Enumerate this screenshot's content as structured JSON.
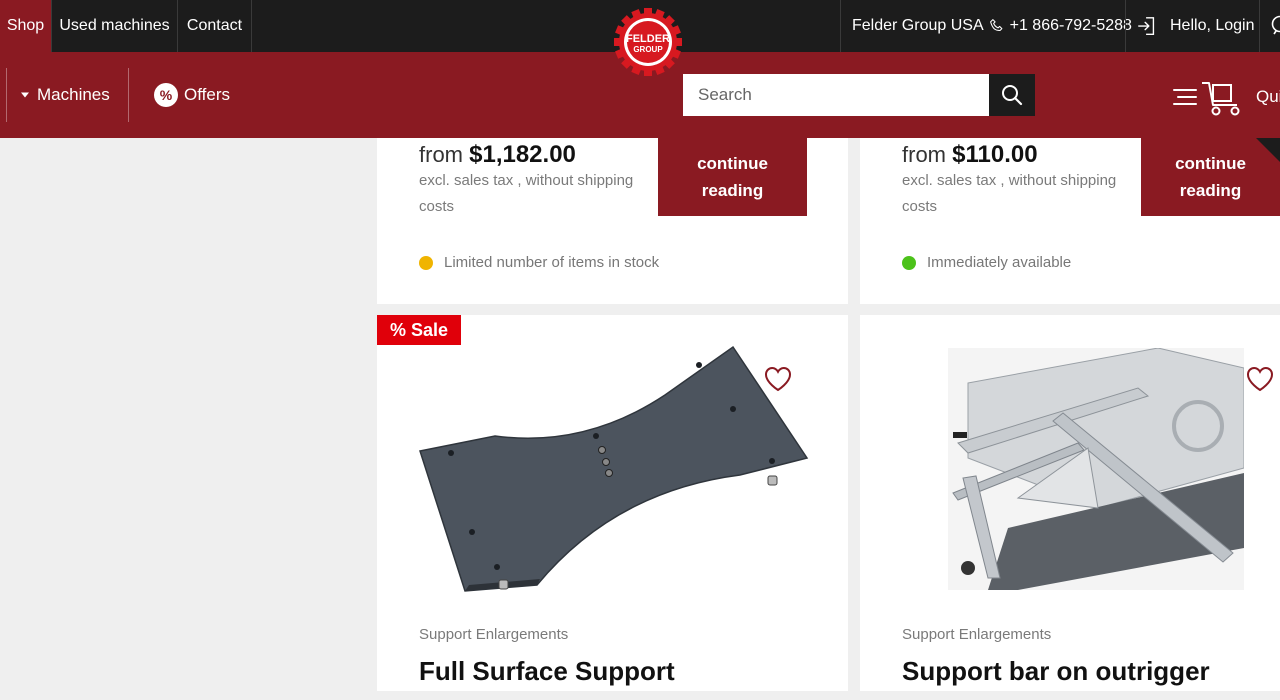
{
  "topbar": {
    "nav": [
      "Shop",
      "Used machines",
      "Contact"
    ],
    "region": "Felder Group USA",
    "phone": "+1 866-792-5288",
    "login": "Hello, Login"
  },
  "logo": {
    "text_top": "FELDER",
    "text_bottom": "GROUP"
  },
  "mainbar": {
    "machines_label": "Machines",
    "offers_label": "Offers",
    "search_placeholder": "Search",
    "quick_label": "Qui"
  },
  "products_top": [
    {
      "price_prefix": "from",
      "price": "$1,182.00",
      "price_note": "excl. sales tax , without shipping costs",
      "button_label_1": "continue",
      "button_label_2": "reading",
      "stock_text": "Limited number of items in stock",
      "stock_color": "#f0b400"
    },
    {
      "price_prefix": "from",
      "price": "$110.00",
      "price_note": "excl. sales tax , without shipping costs",
      "button_label_1": "continue",
      "button_label_2": "reading",
      "stock_text": "Immediately available",
      "stock_color": "#4cc21a"
    }
  ],
  "products_bottom": [
    {
      "badge": "% Sale",
      "category": "Support Enlargements",
      "title": "Full Surface Support"
    },
    {
      "category": "Support Enlargements",
      "title": "Support bar on outrigger"
    }
  ],
  "colors": {
    "brand_red": "#8a1a22",
    "sale_red": "#e0000a",
    "dark": "#1c1c1c"
  }
}
